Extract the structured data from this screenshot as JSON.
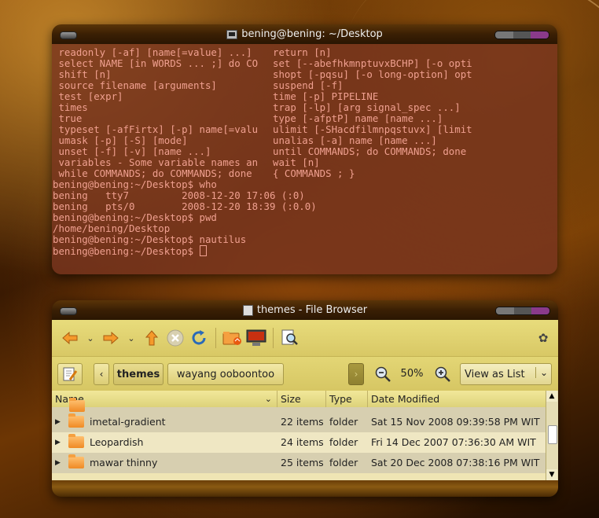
{
  "terminal": {
    "title": "bening@bening: ~/Desktop",
    "lines": [
      {
        "left": " readonly [-af] [name[=value] ...] ",
        "right": "return [n]"
      },
      {
        "left": " select NAME [in WORDS ... ;] do CO",
        "right": "set [--abefhkmnptuvxBCHP] [-o opti"
      },
      {
        "left": " shift [n]",
        "right": "shopt [-pqsu] [-o long-option] opt"
      },
      {
        "left": " source filename [arguments]",
        "right": "suspend [-f]"
      },
      {
        "left": " test [expr]",
        "right": "time [-p] PIPELINE"
      },
      {
        "left": " times",
        "right": "trap [-lp] [arg signal_spec ...]"
      },
      {
        "left": " true",
        "right": "type [-afptP] name [name ...]"
      },
      {
        "left": " typeset [-afFirtx] [-p] name[=valu",
        "right": "ulimit [-SHacdfilmnpqstuvx] [limit"
      },
      {
        "left": " umask [-p] [-S] [mode]",
        "right": "unalias [-a] name [name ...]"
      },
      {
        "left": " unset [-f] [-v] [name ...]",
        "right": "until COMMANDS; do COMMANDS; done"
      },
      {
        "left": " variables - Some variable names an",
        "right": "wait [n]"
      },
      {
        "left": " while COMMANDS; do COMMANDS; done",
        "right": "{ COMMANDS ; }"
      },
      {
        "full": "bening@bening:~/Desktop$ who"
      },
      {
        "full": "bening   tty7         2008-12-20 17:06 (:0)"
      },
      {
        "full": "bening   pts/0        2008-12-20 18:39 (:0.0)"
      },
      {
        "full": "bening@bening:~/Desktop$ pwd"
      },
      {
        "full": "/home/bening/Desktop"
      },
      {
        "full": "bening@bening:~/Desktop$ nautilus"
      },
      {
        "full": "bening@bening:~/Desktop$ "
      }
    ]
  },
  "filebrowser": {
    "title": "themes - File Browser",
    "breadcrumb": {
      "current": "themes",
      "next": "wayang ooboontoo"
    },
    "zoom": "50%",
    "view_mode": "View as List",
    "columns": {
      "name": "Name",
      "size": "Size",
      "type": "Type",
      "date": "Date Modified"
    },
    "rows": [
      {
        "name": "imetal-gradient",
        "size": "22 items",
        "type": "folder",
        "date": "Sat 15 Nov 2008 09:39:58 PM WIT"
      },
      {
        "name": "Leopardish",
        "size": "24 items",
        "type": "folder",
        "date": "Fri 14 Dec 2007 07:36:30 AM WIT"
      },
      {
        "name": "mawar thinny",
        "size": "25 items",
        "type": "folder",
        "date": "Sat 20 Dec 2008 07:38:16 PM WIT"
      }
    ]
  },
  "icons": {
    "back": "back-arrow-icon",
    "forward": "forward-arrow-icon",
    "up": "up-arrow-icon",
    "stop": "stop-icon",
    "reload": "reload-icon",
    "home": "home-folder-icon",
    "computer": "computer-icon",
    "search": "search-icon",
    "edit": "edit-location-icon",
    "zoom_out": "zoom-out-icon",
    "zoom_in": "zoom-in-icon",
    "gnome": "gnome-foot-icon"
  },
  "colors": {
    "terminal_bg": "#78341e",
    "terminal_text": "#f0a090",
    "toolbar": "#e3d675",
    "accent_orange": "#f08a25"
  }
}
